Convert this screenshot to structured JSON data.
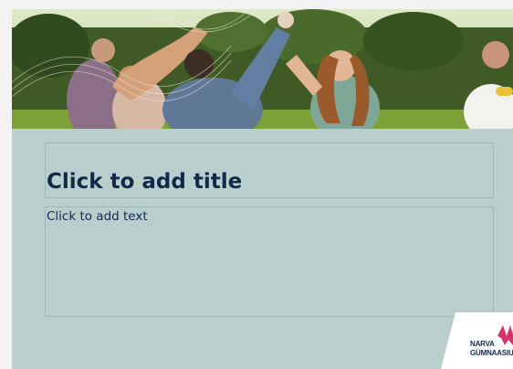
{
  "slide": {
    "title_placeholder": "Click to add title",
    "text_placeholder": "Click to add text"
  },
  "logo": {
    "line1": "NARVA",
    "line2": "GÜMNAASIUM"
  },
  "colors": {
    "slide_background": "#b8cfcd",
    "title_color": "#14294a",
    "logo_accent": "#d6336c"
  },
  "icons": {
    "header_image": "group-of-friends-photo",
    "logo_mark": "narva-gumnaasium-logo"
  }
}
